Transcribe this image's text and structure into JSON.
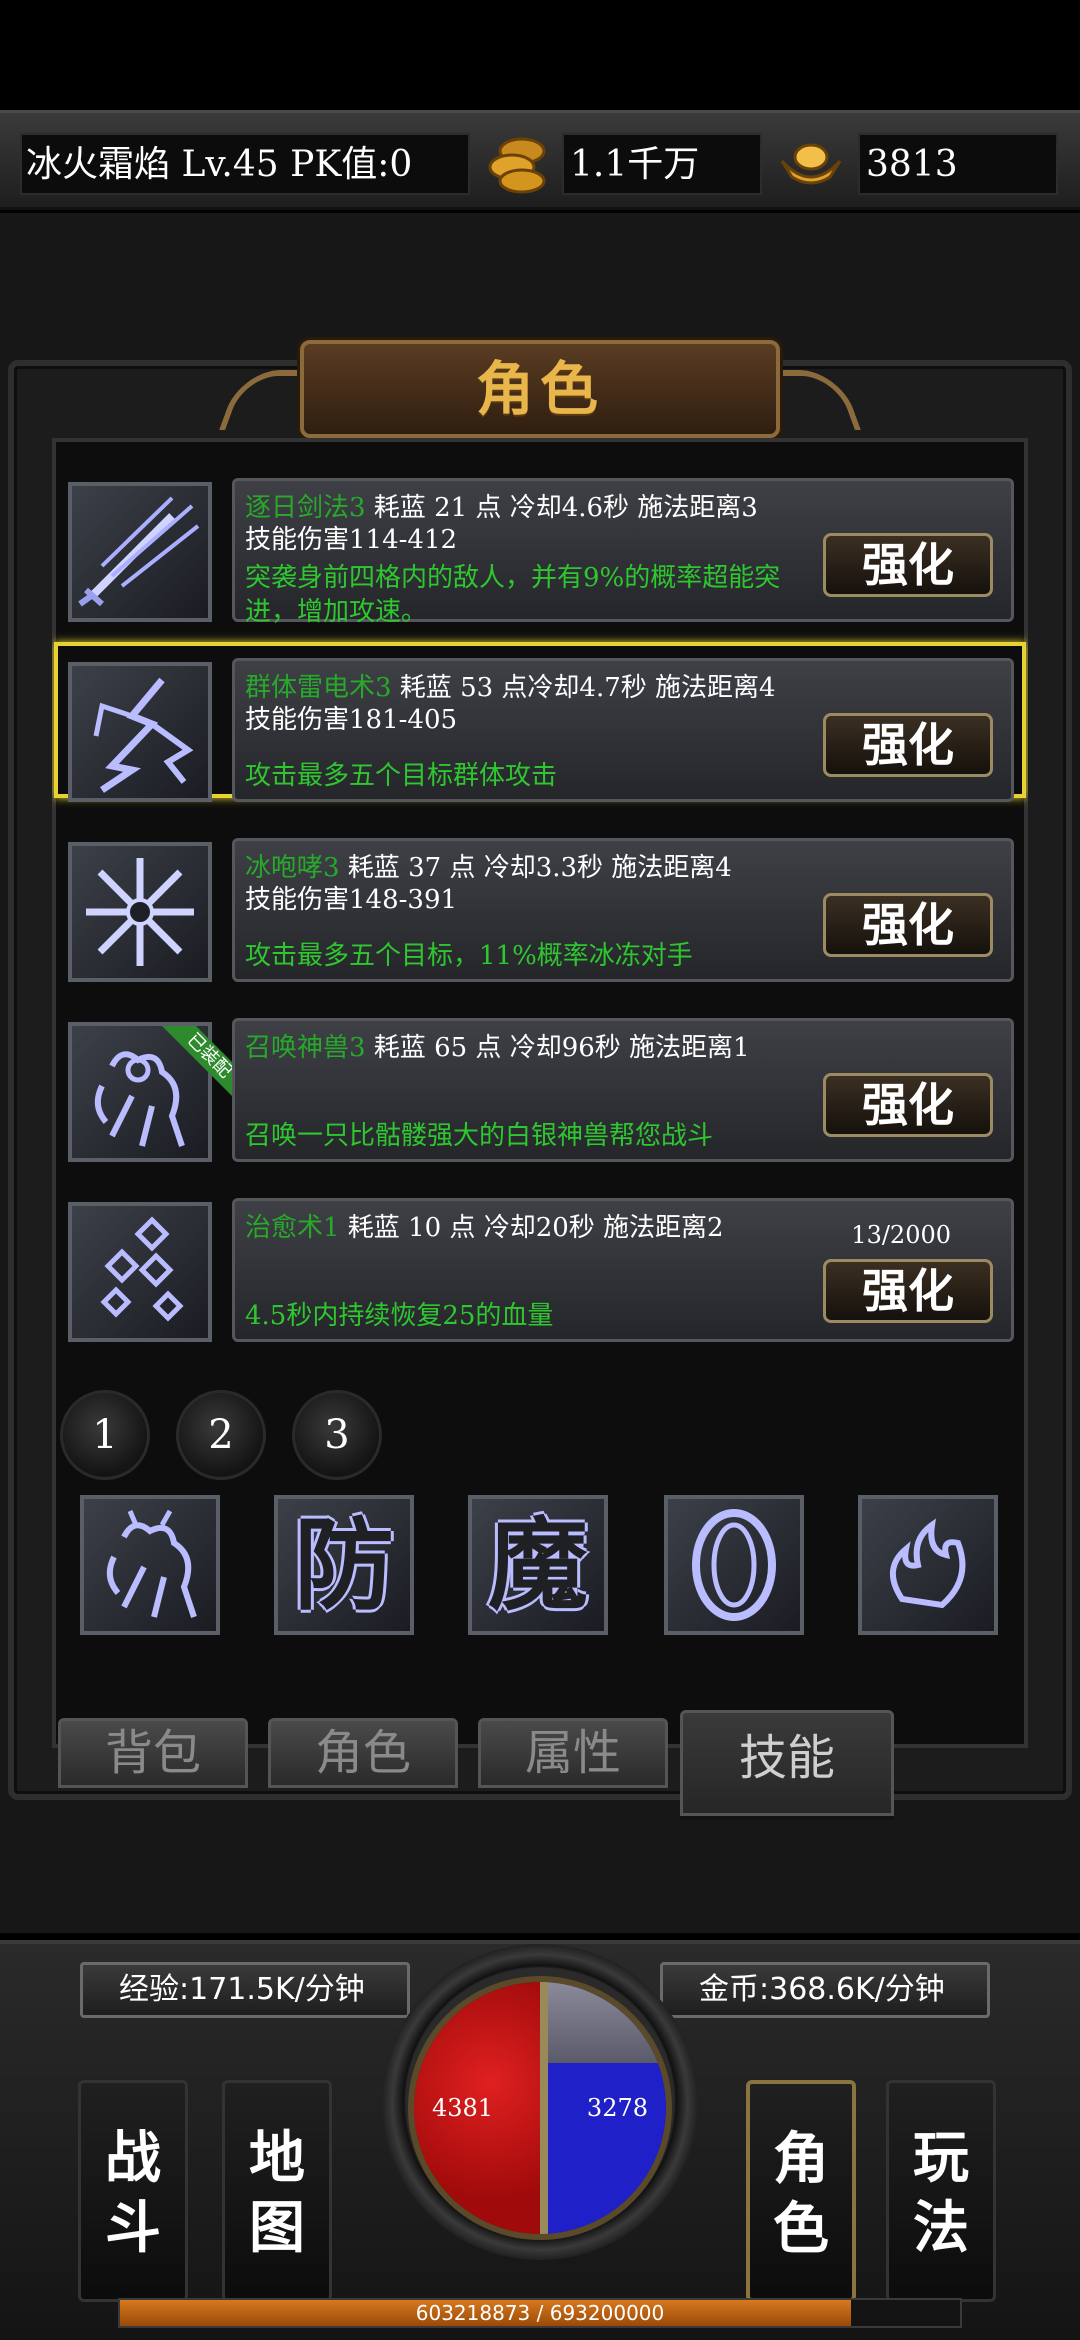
{
  "top_bar": {
    "player": "冰火霜焰  Lv.45 PK值:0",
    "gold": "1.1千万",
    "ingot": "3813"
  },
  "panel_title": "角色",
  "skills": [
    {
      "name": "逐日剑法3",
      "stats": " 耗蓝 21 点    冷却4.6秒    施法距离3",
      "damage": "技能伤害114-412",
      "desc": "突袭身前四格内的敌人，并有9%的概率超能突进，增加攻速。",
      "button": "强化",
      "icon": "sword-icon"
    },
    {
      "name": "群体雷电术3",
      "stats": " 耗蓝 53 点冷却4.7秒    施法距离4",
      "damage": "技能伤害181-405",
      "desc": "攻击最多五个目标群体攻击",
      "button": "强化",
      "icon": "lightning-icon"
    },
    {
      "name": "冰咆哮3",
      "stats": " 耗蓝 37 点    冷却3.3秒    施法距离4",
      "damage": "技能伤害148-391",
      "desc": "攻击最多五个目标，11%概率冰冻对手",
      "button": "强化",
      "icon": "snowflake-icon"
    },
    {
      "name": "召唤神兽3",
      "stats": " 耗蓝 65 点    冷却96秒 施法距离1",
      "damage": "",
      "desc": "召唤一只比骷髅强大的白银神兽帮您战斗",
      "button": "强化",
      "icon": "beast-icon",
      "tag": "已装配"
    },
    {
      "name": "治愈术1",
      "stats": " 耗蓝 10 点    冷却20秒 施法距离2",
      "damage": "",
      "desc": "4.5秒内持续恢复25的血量",
      "button": "强化",
      "count": "13/2000",
      "icon": "heal-icon"
    }
  ],
  "pages": [
    "1",
    "2",
    "3"
  ],
  "categories": [
    {
      "label": "",
      "icon": "beast-icon"
    },
    {
      "label": "防",
      "icon": "defense-glyph"
    },
    {
      "label": "魔",
      "icon": "magic-glyph"
    },
    {
      "label": "",
      "icon": "shield-ring-icon"
    },
    {
      "label": "",
      "icon": "flame-icon"
    }
  ],
  "tabs": {
    "bag": "背包",
    "role": "角色",
    "attr": "属性",
    "skill": "技能"
  },
  "rates": {
    "exp": "经验:171.5K/分钟",
    "gold": "金币:368.6K/分钟"
  },
  "nav": {
    "battle": "战斗",
    "map": "地图",
    "role": "角色",
    "play": "玩法"
  },
  "orb": {
    "hp": "4381",
    "mp": "3278"
  },
  "exp_bar": {
    "text": "603218873 / 693200000",
    "fraction": 0.87
  },
  "colors": {
    "skill_name": "#27a92a",
    "desc": "#2fc72f",
    "selected_frame": "#e6d230",
    "title_gold": "#e8b64a"
  }
}
